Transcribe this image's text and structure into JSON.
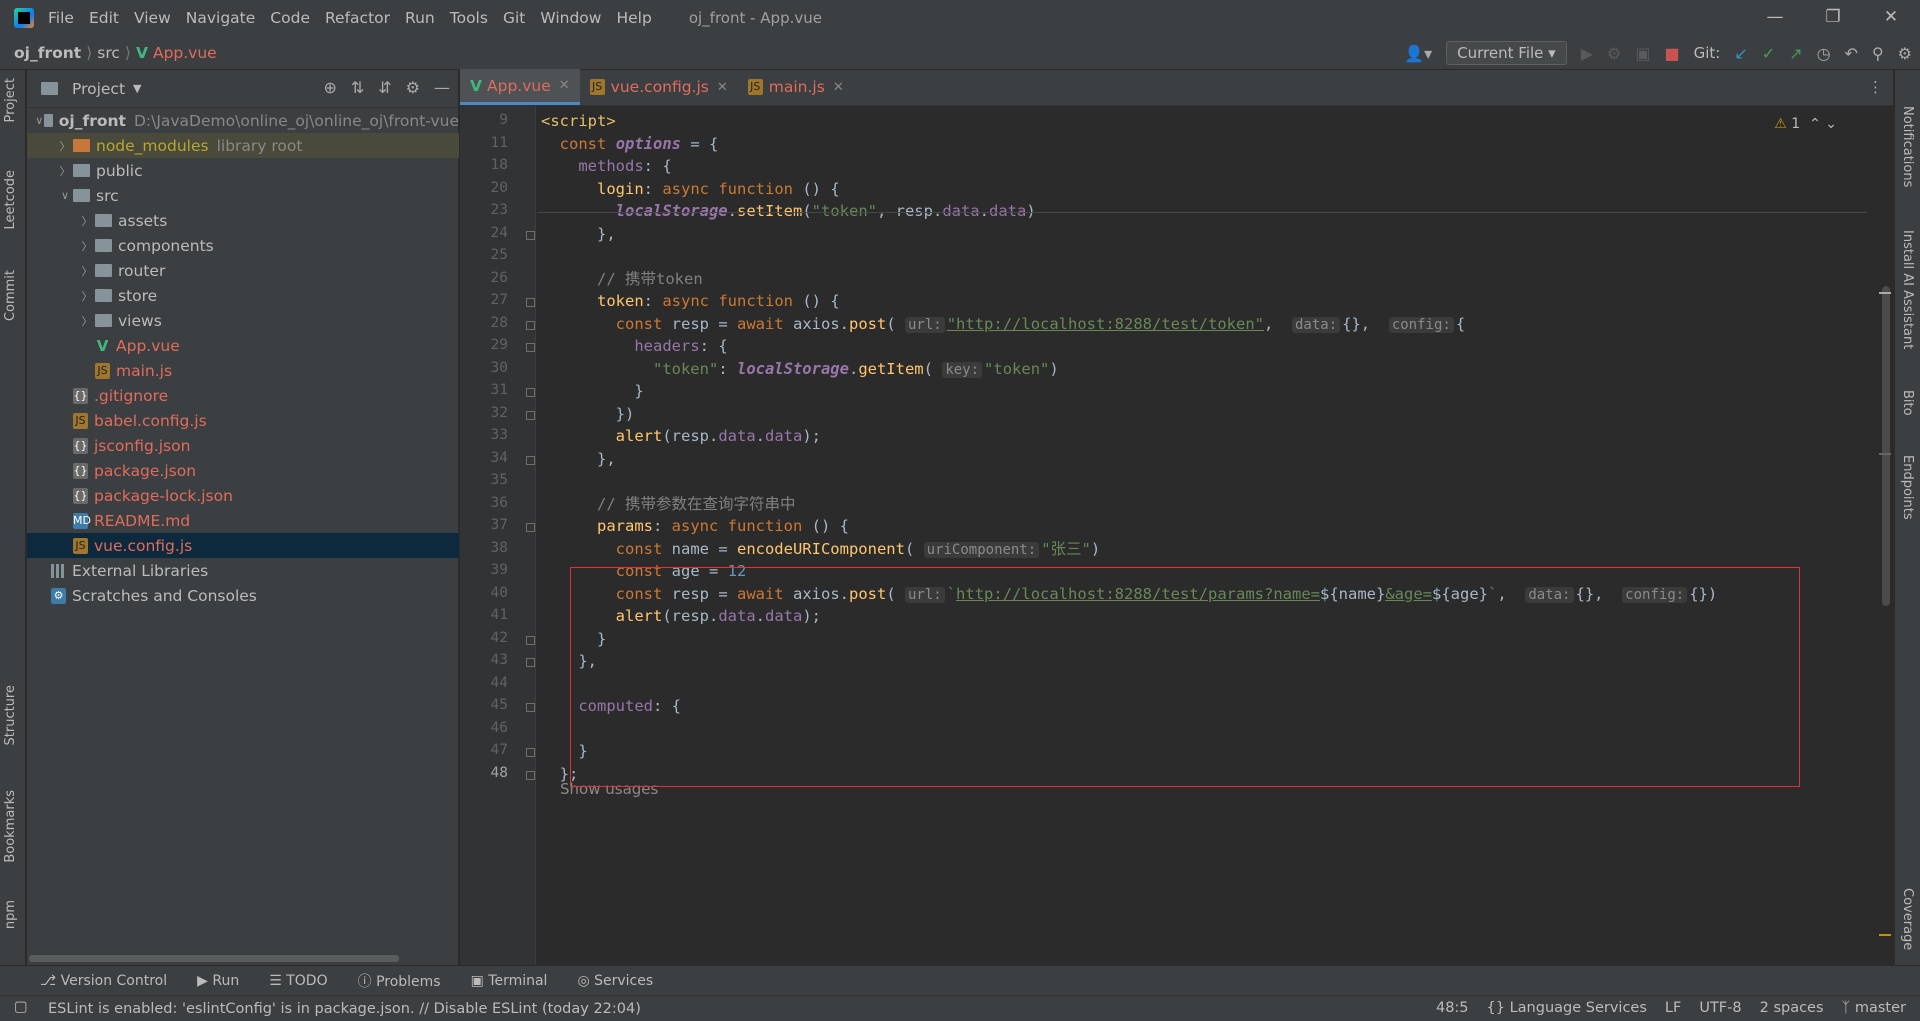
{
  "window": {
    "menu": [
      "File",
      "Edit",
      "View",
      "Navigate",
      "Code",
      "Refactor",
      "Run",
      "Tools",
      "Git",
      "Window",
      "Help"
    ],
    "title": "oj_front - App.vue"
  },
  "breadcrumb": [
    "oj_front",
    "src",
    "App.vue"
  ],
  "toolbar": {
    "run_config": "Current File",
    "git_label": "Git:"
  },
  "project": {
    "panel_title": "Project",
    "tree": [
      {
        "label": "oj_front",
        "extra": "D:\\JavaDemo\\online_oj\\online_oj\\front-vue",
        "type": "folder",
        "depth": 0,
        "open": true,
        "bold": true
      },
      {
        "label": "node_modules",
        "extra": "library root",
        "type": "folder-orange",
        "depth": 1,
        "color": "yellow"
      },
      {
        "label": "public",
        "type": "folder",
        "depth": 1
      },
      {
        "label": "src",
        "type": "folder",
        "depth": 1,
        "open": true
      },
      {
        "label": "assets",
        "type": "folder",
        "depth": 2
      },
      {
        "label": "components",
        "type": "folder",
        "depth": 2
      },
      {
        "label": "router",
        "type": "folder",
        "depth": 2
      },
      {
        "label": "store",
        "type": "folder",
        "depth": 2
      },
      {
        "label": "views",
        "type": "folder",
        "depth": 2
      },
      {
        "label": "App.vue",
        "type": "vue",
        "depth": 2,
        "color": "red"
      },
      {
        "label": "main.js",
        "type": "js",
        "depth": 2,
        "color": "red"
      },
      {
        "label": ".gitignore",
        "type": "json",
        "depth": 1,
        "color": "red"
      },
      {
        "label": "babel.config.js",
        "type": "js",
        "depth": 1,
        "color": "red"
      },
      {
        "label": "jsconfig.json",
        "type": "json",
        "depth": 1,
        "color": "red"
      },
      {
        "label": "package.json",
        "type": "json",
        "depth": 1,
        "color": "red"
      },
      {
        "label": "package-lock.json",
        "type": "json",
        "depth": 1,
        "color": "red"
      },
      {
        "label": "README.md",
        "type": "md",
        "depth": 1,
        "color": "red"
      },
      {
        "label": "vue.config.js",
        "type": "js",
        "depth": 1,
        "color": "red",
        "selected": true
      },
      {
        "label": "External Libraries",
        "type": "lib",
        "depth": 0
      },
      {
        "label": "Scratches and Consoles",
        "type": "scratch",
        "depth": 0
      }
    ]
  },
  "tabs": [
    {
      "label": "App.vue",
      "icon": "vue",
      "active": true
    },
    {
      "label": "vue.config.js",
      "icon": "js"
    },
    {
      "label": "main.js",
      "icon": "js"
    }
  ],
  "side_left": [
    "Project",
    "Leetcode",
    "Commit",
    "Structure",
    "Bookmarks",
    "npm"
  ],
  "side_right": [
    "Notifications",
    "Install AI Assistant",
    "Bito",
    "Endpoints",
    "Coverage"
  ],
  "editor": {
    "warning_count": "1",
    "show_usages": "Show usages",
    "lines": [
      {
        "n": "9",
        "html": "<span class='tag'>&lt;script&gt;</span>"
      },
      {
        "n": "11",
        "html": "  <span class='kw'>const</span> <span class='ls' style='font-style:italic'>options</span> = {"
      },
      {
        "n": "18",
        "html": "    <span class='prop'>methods</span>: {"
      },
      {
        "n": "20",
        "html": "      <span class='fn'>login</span>: <span class='kw'>async function</span> () {"
      },
      {
        "n": "23",
        "html": "        <span class='ls'>localStorage</span>.<span class='fn'>setItem</span>(<span class='str'>\"token\"</span>, resp.<span class='prop'>data</span>.<span class='prop'>data</span>)"
      },
      {
        "n": "24",
        "html": "      },"
      },
      {
        "n": "25",
        "html": ""
      },
      {
        "n": "26",
        "html": "      <span class='cm'>// 携带token</span>"
      },
      {
        "n": "27",
        "html": "      <span class='fn'>token</span>: <span class='kw'>async function</span> () {"
      },
      {
        "n": "28",
        "html": "        <span class='kw'>const</span> resp = <span class='kw'>await</span> axios.<span class='fn'>post</span>( <span class='hint'>url:</span><span class='url'>\"http://localhost:8288/test/token\"</span>,  <span class='hint'>data:</span>{},  <span class='hint'>config:</span>{"
      },
      {
        "n": "29",
        "html": "          <span class='prop'>headers</span>: {"
      },
      {
        "n": "30",
        "html": "            <span class='str'>\"token\"</span>: <span class='ls'>localStorage</span>.<span class='fn'>getItem</span>( <span class='hint'>key:</span><span class='str'>\"token\"</span>)"
      },
      {
        "n": "31",
        "html": "          }"
      },
      {
        "n": "32",
        "html": "        })"
      },
      {
        "n": "33",
        "html": "        <span class='fn'>alert</span>(resp.<span class='prop'>data</span>.<span class='prop'>data</span>);"
      },
      {
        "n": "34",
        "html": "      },"
      },
      {
        "n": "35",
        "html": ""
      },
      {
        "n": "36",
        "html": "      <span class='cm'>// 携带参数在查询字符串中</span>"
      },
      {
        "n": "37",
        "html": "      <span class='fn'>params</span>: <span class='kw'>async function</span> () {"
      },
      {
        "n": "38",
        "html": "        <span class='kw'>const</span> name = <span class='fn'>encodeURIComponent</span>( <span class='hint'>uriComponent:</span><span class='str'>\"张三\"</span>)"
      },
      {
        "n": "39",
        "html": "        <span class='kw'>const</span> age = <span class='num'>12</span>"
      },
      {
        "n": "40",
        "html": "        <span class='kw'>const</span> resp = <span class='kw'>await</span> axios.<span class='fn'>post</span>( <span class='hint'>url:</span><span class='str'>`</span><span class='url'>http://localhost:8288/test/params?name=</span>${name}<span class='url'>&amp;age=</span>${age}<span class='str'>`</span>,  <span class='hint'>data:</span>{},  <span class='hint'>config:</span>{})"
      },
      {
        "n": "41",
        "html": "        <span class='fn'>alert</span>(resp.<span class='prop'>data</span>.<span class='prop'>data</span>);"
      },
      {
        "n": "42",
        "html": "      }"
      },
      {
        "n": "43",
        "html": "    },"
      },
      {
        "n": "44",
        "html": ""
      },
      {
        "n": "45",
        "html": "    <span class='prop'>computed</span>: {"
      },
      {
        "n": "46",
        "html": ""
      },
      {
        "n": "47",
        "html": "    }"
      },
      {
        "n": "48",
        "html": "  };"
      }
    ]
  },
  "tool_windows": [
    "Version Control",
    "Run",
    "TODO",
    "Problems",
    "Terminal",
    "Services"
  ],
  "status": {
    "message": "ESLint is enabled: 'eslintConfig' is in package.json. // Disable ESLint (today 22:04)",
    "position": "48:5",
    "language_services": "{} Language Services",
    "line_sep": "LF",
    "encoding": "UTF-8",
    "indent": "2 spaces",
    "branch": "master"
  }
}
